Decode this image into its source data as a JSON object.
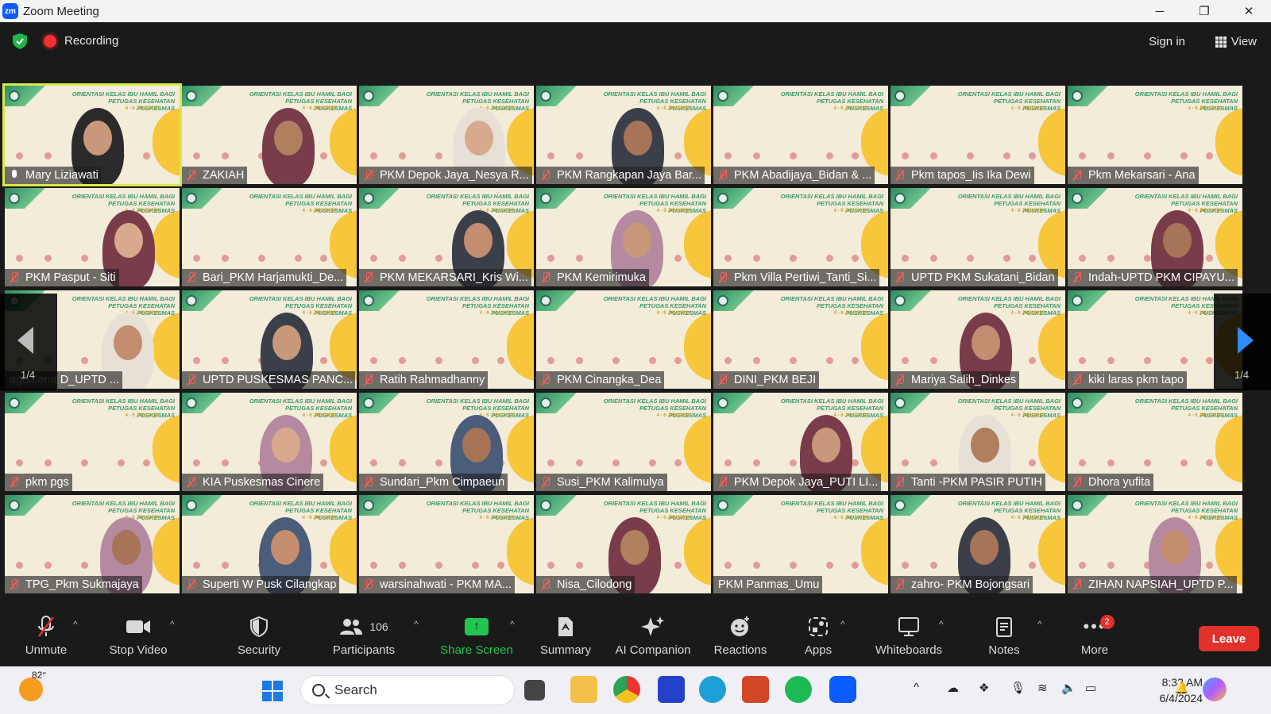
{
  "window": {
    "app_title": "Zoom Meeting",
    "minimize": "─",
    "restore": "❐",
    "close": "✕"
  },
  "topbar": {
    "recording_label": "Recording",
    "sign_in": "Sign in",
    "view_label": "View"
  },
  "gallery": {
    "page_left": "1/4",
    "page_right": "1/4",
    "tiles": [
      {
        "name": "Mary Liziawati",
        "muted": false,
        "active": true,
        "person": true
      },
      {
        "name": "ZAKIAH",
        "muted": true,
        "person": true
      },
      {
        "name": "PKM Depok Jaya_Nesya R...",
        "muted": true,
        "person": true
      },
      {
        "name": "PKM Rangkapan Jaya Bar...",
        "muted": true,
        "person": true
      },
      {
        "name": "PKM Abadijaya_Bidan & ...",
        "muted": true,
        "person": false
      },
      {
        "name": "Pkm tapos_Iis Ika Dewi",
        "muted": true,
        "person": false
      },
      {
        "name": "Pkm Mekarsari - Ana",
        "muted": true,
        "person": false
      },
      {
        "name": "PKM Pasput - Siti",
        "muted": true,
        "person": true
      },
      {
        "name": "Bari_PKM Harjamukti_De...",
        "muted": true,
        "person": false
      },
      {
        "name": "PKM MEKARSARI_Kris Wi...",
        "muted": true,
        "person": true
      },
      {
        "name": "PKM Kemirimuka",
        "muted": true,
        "person": true
      },
      {
        "name": "Pkm Villa Pertiwi_Tanti_Si...",
        "muted": true,
        "person": false
      },
      {
        "name": "UPTD PKM Sukatani_Bidan",
        "muted": true,
        "person": false
      },
      {
        "name": "Indah-UPTD PKM CIPAYU...",
        "muted": true,
        "person": true
      },
      {
        "name": "agdalena D_UPTD ...",
        "muted": false,
        "person": true,
        "noicon": true
      },
      {
        "name": "UPTD PUSKESMAS PANC...",
        "muted": true,
        "person": true
      },
      {
        "name": "Ratih Rahmadhanny",
        "muted": true,
        "person": false
      },
      {
        "name": "PKM Cinangka_Dea",
        "muted": true,
        "person": false
      },
      {
        "name": "DINI_PKM BEJI",
        "muted": true,
        "person": false
      },
      {
        "name": "Mariya Salih_Dinkes",
        "muted": true,
        "person": true
      },
      {
        "name": "kiki laras pkm tapo",
        "muted": true,
        "person": false
      },
      {
        "name": "pkm pgs",
        "muted": true,
        "person": false
      },
      {
        "name": "KIA Puskesmas Cinere",
        "muted": true,
        "person": true
      },
      {
        "name": "Sundari_Pkm Cimpaeun",
        "muted": true,
        "person": true
      },
      {
        "name": "Susi_PKM Kalimulya",
        "muted": true,
        "person": false
      },
      {
        "name": "PKM Depok Jaya_PUTI LI...",
        "muted": true,
        "person": true
      },
      {
        "name": "Tanti -PKM PASIR PUTIH",
        "muted": true,
        "person": true
      },
      {
        "name": "Dhora yufita",
        "muted": true,
        "person": false
      },
      {
        "name": "TPG_Pkm Sukmajaya",
        "muted": true,
        "person": true
      },
      {
        "name": "Superti W Pusk Cilangkap",
        "muted": true,
        "person": true
      },
      {
        "name": "warsinahwati - PKM MA...",
        "muted": true,
        "person": false
      },
      {
        "name": "Nisa_Cilodong",
        "muted": true,
        "person": true
      },
      {
        "name": "PKM Panmas_Umu",
        "muted": false,
        "person": false,
        "noicon": true
      },
      {
        "name": "zahro- PKM Bojongsari",
        "muted": true,
        "person": true
      },
      {
        "name": "ZIHAN NAPSIAH_UPTD P...",
        "muted": true,
        "person": true
      }
    ],
    "banner_line1": "ORIENTASI KELAS IBU HAMIL BAGI",
    "banner_line2": "PETUGAS KESEHATAN PUSKESMAS",
    "banner_date": "4 - 6 JUNI 2024"
  },
  "toolbar": {
    "unmute": "Unmute",
    "stop_video": "Stop Video",
    "security": "Security",
    "participants": "Participants",
    "participants_count": "106",
    "share_screen": "Share Screen",
    "summary": "Summary",
    "ai_companion": "AI Companion",
    "reactions": "Reactions",
    "apps": "Apps",
    "whiteboards": "Whiteboards",
    "notes": "Notes",
    "more": "More",
    "more_badge": "2",
    "leave": "Leave"
  },
  "taskbar": {
    "temperature": "82°",
    "search_placeholder": "Search",
    "time": "8:32 AM",
    "date": "6/4/2024"
  },
  "colors": {
    "accent_green": "#23c552",
    "leave_red": "#e0312b",
    "active_outline": "#d8e84b",
    "nav_blue": "#2d8cff"
  }
}
